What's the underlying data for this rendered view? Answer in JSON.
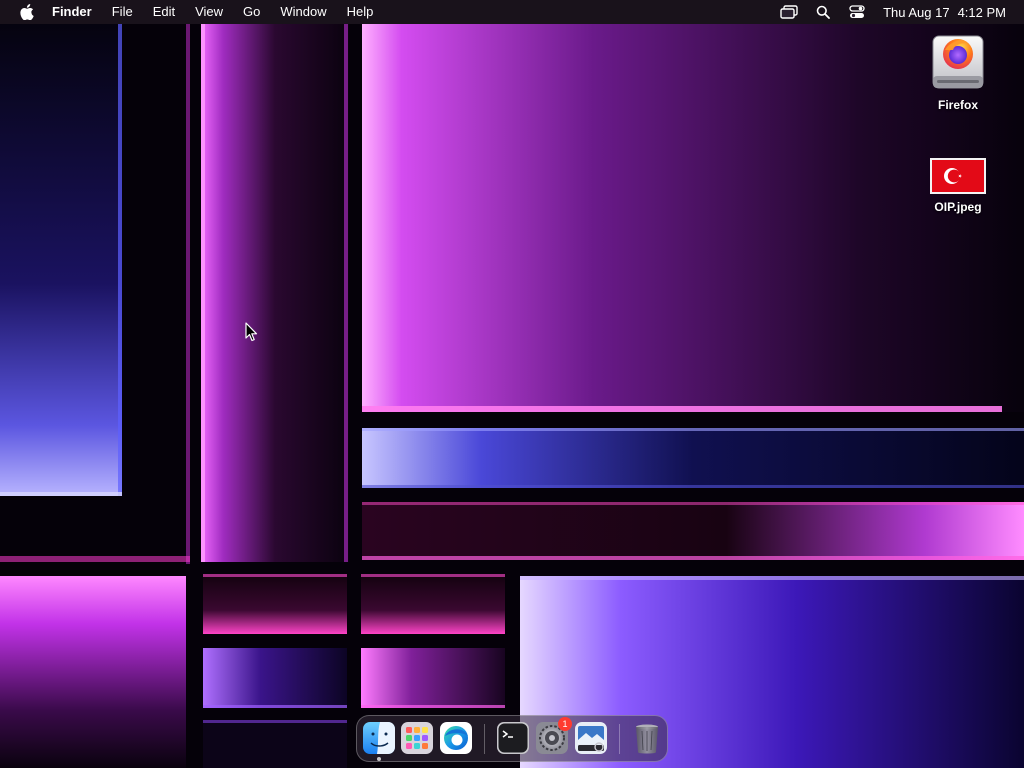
{
  "menubar": {
    "app_name": "Finder",
    "menus": [
      "File",
      "Edit",
      "View",
      "Go",
      "Window",
      "Help"
    ],
    "clock_date": "Thu Aug 17",
    "clock_time": "4:12 PM",
    "status_icons": [
      "screen-mirroring-icon",
      "spotlight-search-icon",
      "control-center-icon"
    ]
  },
  "desktop": {
    "icons": [
      {
        "label": "Firefox",
        "icon": "firefox-drive-icon"
      },
      {
        "label": "OIP.jpeg",
        "icon": "turkey-flag-thumbnail"
      }
    ]
  },
  "dock": {
    "items": [
      {
        "name": "Finder",
        "icon": "finder-icon",
        "running": true
      },
      {
        "name": "Launchpad",
        "icon": "launchpad-icon",
        "running": false
      },
      {
        "name": "Microsoft Edge",
        "icon": "edge-icon",
        "running": false
      },
      {
        "name": "Terminal",
        "icon": "terminal-icon",
        "running": false
      },
      {
        "name": "System Settings",
        "icon": "system-settings-icon",
        "running": false,
        "badge": "1"
      },
      {
        "name": "Preview",
        "icon": "preview-icon",
        "running": false
      },
      {
        "name": "Trash",
        "icon": "trash-icon",
        "running": false
      }
    ]
  },
  "colors": {
    "wallpaper_magenta": "#e040ff",
    "wallpaper_violet": "#7a5cff",
    "menubar_bg": "#1c141e",
    "badge_red": "#ff3b30",
    "flag_red": "#e30a17"
  }
}
